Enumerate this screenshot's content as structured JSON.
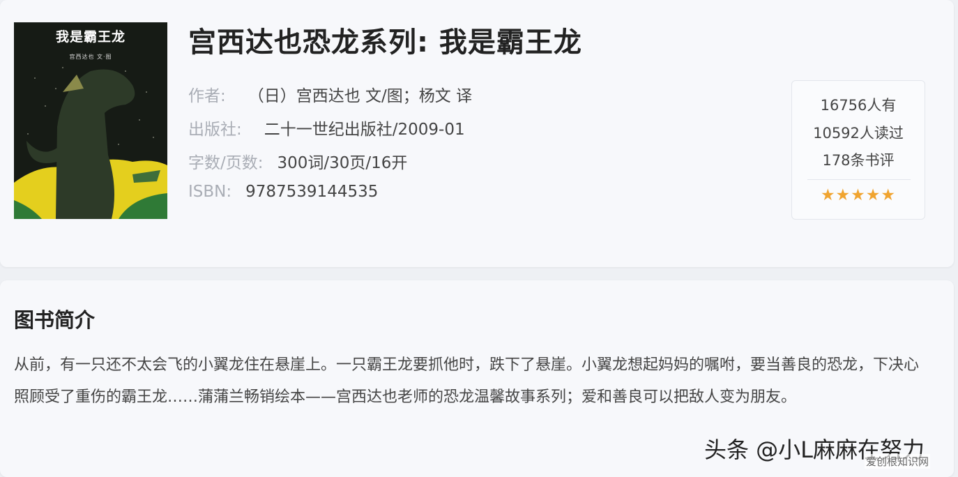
{
  "book": {
    "title": "宫西达也恐龙系列: 我是霸王龙",
    "cover": {
      "title": "我是霸王龙",
      "subtitle": "宫西达也 文·图"
    },
    "meta": [
      {
        "label": "作者:",
        "value": "（日）宫西达也 文/图；杨文 译"
      },
      {
        "label": "出版社:",
        "value": "二十一世纪出版社/2009-01"
      },
      {
        "label": "字数/页数:",
        "value": "300词/30页/16开"
      },
      {
        "label": "ISBN:",
        "value": "9787539144535"
      }
    ]
  },
  "stats": {
    "have": "16756人有",
    "read": "10592人读过",
    "reviews": "178条书评",
    "rating": 5,
    "stars": "★★★★★",
    "star_color": "#f0a430"
  },
  "intro": {
    "heading": "图书简介",
    "text": "从前，有一只还不太会飞的小翼龙住在悬崖上。一只霸王龙要抓他时，跌下了悬崖。小翼龙想起妈妈的嘱咐，要当善良的恐龙，下决心照顾受了重伤的霸王龙……蒲蒲兰畅销绘本——宫西达也老师的恐龙温馨故事系列；爱和善良可以把敌人变为朋友。"
  },
  "watermark": {
    "author": "头条 @小L麻麻在努力",
    "site": "爱创根知识网"
  }
}
